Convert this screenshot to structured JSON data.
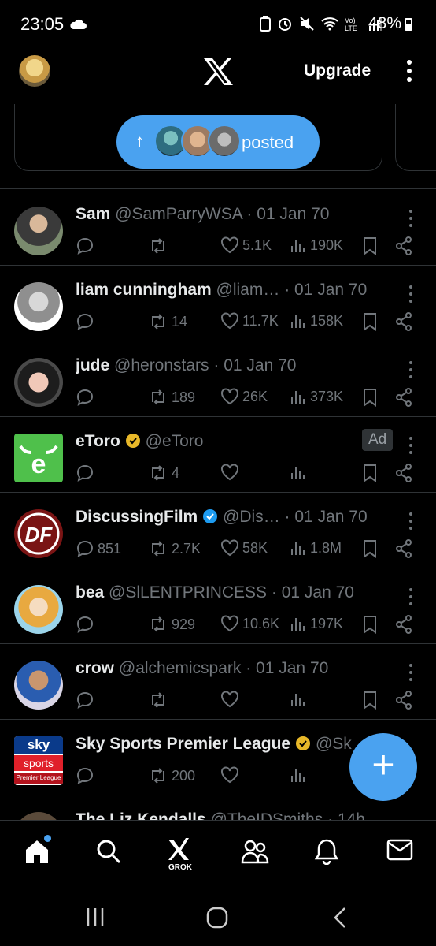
{
  "status_bar": {
    "time": "23:05",
    "battery": "48%"
  },
  "top_nav": {
    "upgrade_label": "Upgrade"
  },
  "posted_pill": {
    "label": "posted"
  },
  "colors": {
    "accent": "#4aa2f0",
    "gold_badge": "#e8b829",
    "blue_badge": "#1d9bf0",
    "muted": "#71767b"
  },
  "feed": [
    {
      "name": "Sam",
      "handle": "@SamParryWSA",
      "time": "· 01 Jan 70",
      "reply": "",
      "repost": "",
      "like": "5.1K",
      "views": "190K",
      "badge": ""
    },
    {
      "name": "liam cunningham",
      "handle": "@liam…",
      "time": "· 01 Jan 70",
      "reply": "",
      "repost": "14",
      "like": "11.7K",
      "views": "158K",
      "badge": ""
    },
    {
      "name": "jude",
      "handle": "@heronstars",
      "time": "· 01 Jan 70",
      "reply": "",
      "repost": "189",
      "like": "26K",
      "views": "373K",
      "badge": ""
    },
    {
      "name": "eToro",
      "handle": "@eToro",
      "time": "",
      "reply": "",
      "repost": "4",
      "like": "",
      "views": "",
      "badge": "gold",
      "ad_label": "Ad"
    },
    {
      "name": "DiscussingFilm",
      "handle": "@Dis…",
      "time": "· 01 Jan 70",
      "reply": "851",
      "repost": "2.7K",
      "like": "58K",
      "views": "1.8M",
      "badge": "blue"
    },
    {
      "name": "bea",
      "handle": "@SlLENTPRINCESS",
      "time": "· 01 Jan 70",
      "reply": "",
      "repost": "929",
      "like": "10.6K",
      "views": "197K",
      "badge": ""
    },
    {
      "name": "crow",
      "handle": "@alchemicspark",
      "time": "· 01 Jan 70",
      "reply": "",
      "repost": "",
      "like": "",
      "views": "",
      "badge": ""
    },
    {
      "name": "Sky Sports Premier League",
      "handle": "@Sk",
      "time": "",
      "reply": "",
      "repost": "200",
      "like": "",
      "views": "",
      "badge": "gold"
    },
    {
      "name": "The Liz Kendalls",
      "handle": "@TheIDSmiths",
      "time": "· 14h",
      "reply": "",
      "repost": "",
      "like": "",
      "views": "",
      "badge": ""
    }
  ],
  "sky_logo": {
    "line1": "sky",
    "line2": "sports",
    "line3": "Premier League"
  },
  "bottom_nav": {
    "grok_label": "GROK"
  }
}
